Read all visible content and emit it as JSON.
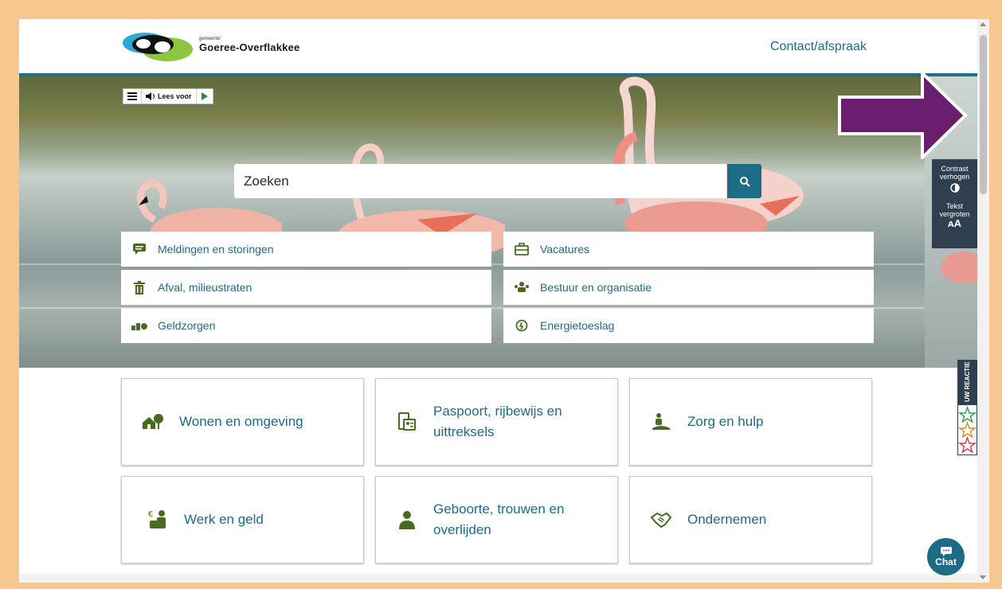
{
  "header": {
    "logo_small": "gemeente",
    "logo_name": "Goeree-Overflakkee",
    "contact_link": "Contact/afspraak"
  },
  "read_toolbar": {
    "lees_voor": "Lees voor"
  },
  "search": {
    "placeholder": "Zoeken"
  },
  "quick_links": [
    {
      "label": "Meldingen en storingen",
      "icon": "speech-bubble-icon"
    },
    {
      "label": "Vacatures",
      "icon": "briefcase-icon"
    },
    {
      "label": "Afval, milieustraten",
      "icon": "trash-icon"
    },
    {
      "label": "Bestuur en organisatie",
      "icon": "people-icon"
    },
    {
      "label": "Geldzorgen",
      "icon": "money-icon"
    },
    {
      "label": "Energietoeslag",
      "icon": "energy-icon"
    }
  ],
  "side_tools": {
    "contrast_line1": "Contrast",
    "contrast_line2": "verhogen",
    "text_line1": "Tekst",
    "text_line2": "vergroten",
    "text_glyph": "ᴀA"
  },
  "feedback": {
    "label": "UW REACTIE"
  },
  "tiles": [
    {
      "label": "Wonen en omgeving",
      "icon": "house-tree-icon"
    },
    {
      "label": "Paspoort, rijbewijs en uittreksels",
      "icon": "documents-icon"
    },
    {
      "label": "Zorg en hulp",
      "icon": "care-icon"
    },
    {
      "label": "Werk en geld",
      "icon": "work-money-icon"
    },
    {
      "label": "Geboorte, trouwen en overlijden",
      "icon": "person-icon"
    },
    {
      "label": "Ondernemen",
      "icon": "handshake-icon"
    }
  ],
  "chat": {
    "label": "Chat"
  },
  "colors": {
    "primary": "#1c6b87",
    "icon_green": "#4a6b1f",
    "frame": "#f6c78f",
    "arrow": "#6a1f6e"
  }
}
